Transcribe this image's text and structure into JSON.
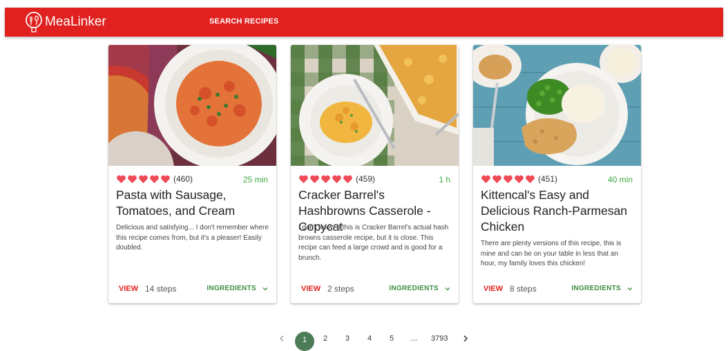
{
  "app": {
    "brand": "MeaLinker",
    "nav_search": "SEARCH RECIPES"
  },
  "colors": {
    "brand_red": "#e0211f",
    "time_green": "#3ea943",
    "ingredients_green": "#3e8e41",
    "active_page": "#4c7d57",
    "heart": "#ef4b57"
  },
  "recipes": [
    {
      "rating_count": "(460)",
      "rating": 5,
      "time": "25 min",
      "title": "Pasta with Sausage, Tomatoes, and Cream",
      "description": "Delicious and satisfying... I don't remember where this recipe comes from, but it's a pleaser! Easily doubled.",
      "view_label": "VIEW",
      "steps": "14 steps",
      "ingredients_label": "INGREDIENTS",
      "image": "pasta-dish-photo"
    },
    {
      "rating_count": "(459)",
      "rating": 5,
      "time": "1 h",
      "title": "Cracker Barrel's Hashbrowns Casserole - Copycat",
      "description": "I don't know if this is Cracker Barrel's actual hash browns casserole recipe, but it is close. This recipe can feed a large crowd and is good for a brunch.",
      "view_label": "VIEW",
      "steps": "2 steps",
      "ingredients_label": "INGREDIENTS",
      "image": "casserole-photo"
    },
    {
      "rating_count": "(451)",
      "rating": 5,
      "time": "40 min",
      "title": "Kittencal's Easy and Delicious Ranch-Parmesan Chicken",
      "description": "There are plenty versions of this recipe, this is mine and can be on your table in less that an hour, my family loves this chicken!",
      "view_label": "VIEW",
      "steps": "8 steps",
      "ingredients_label": "INGREDIENTS",
      "image": "chicken-dish-photo"
    }
  ],
  "pagination": {
    "current": "1",
    "pages": [
      "2",
      "3",
      "4",
      "5"
    ],
    "ellipsis": "...",
    "last": "3793"
  }
}
